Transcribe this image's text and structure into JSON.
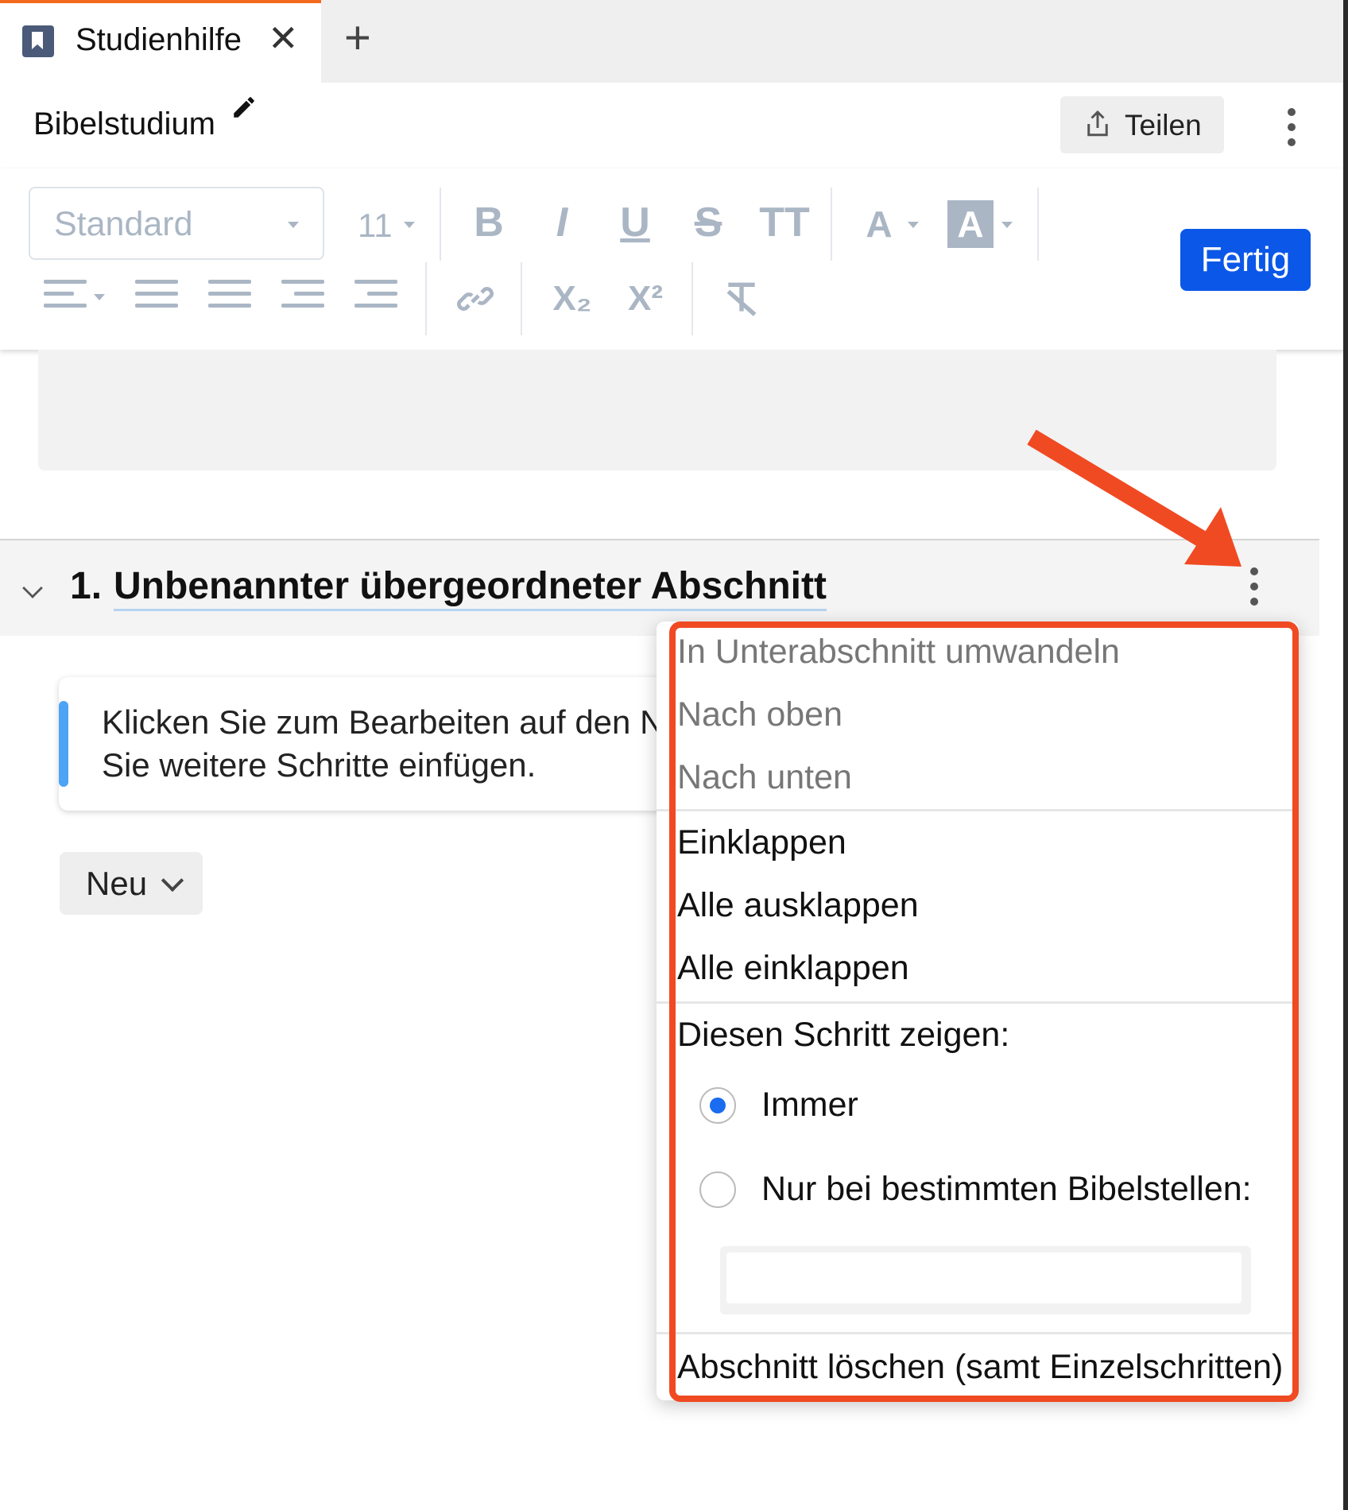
{
  "tab": {
    "title": "Studienhilfe",
    "close": "✕",
    "add": "+"
  },
  "doc": {
    "title": "Bibelstudium",
    "share_label": "Teilen"
  },
  "toolbar": {
    "style_value": "Standard",
    "font_size": "11",
    "bold": "B",
    "italic": "I",
    "underline": "U",
    "strike": "S",
    "case": "TT",
    "font_color": "A",
    "highlight": "A",
    "subscript": "X₂",
    "superscript": "X²",
    "done_label": "Fertig"
  },
  "section": {
    "number": "1.",
    "title": "Unbenannter übergeordneter Abschnitt",
    "hint": "Klicken Sie zum Bearbeiten auf den N\nSie weitere Schritte einfügen.",
    "new_label": "Neu"
  },
  "menu": {
    "convert": "In Unterabschnitt umwandeln",
    "move_up": "Nach oben",
    "move_down": "Nach unten",
    "collapse": "Einklappen",
    "expand_all": "Alle ausklappen",
    "collapse_all": "Alle einklappen",
    "show_step_label": "Diesen Schritt zeigen:",
    "option_always": "Immer",
    "option_specific": "Nur bei bestimmten Bibelstellen:",
    "reference_value": "",
    "delete": "Abschnitt löschen (samt Einzelschritten)",
    "selected_option": "Immer"
  },
  "colors": {
    "accent": "#0b57e8",
    "annotation": "#f04a23",
    "tab_accent": "#f26b1d"
  }
}
